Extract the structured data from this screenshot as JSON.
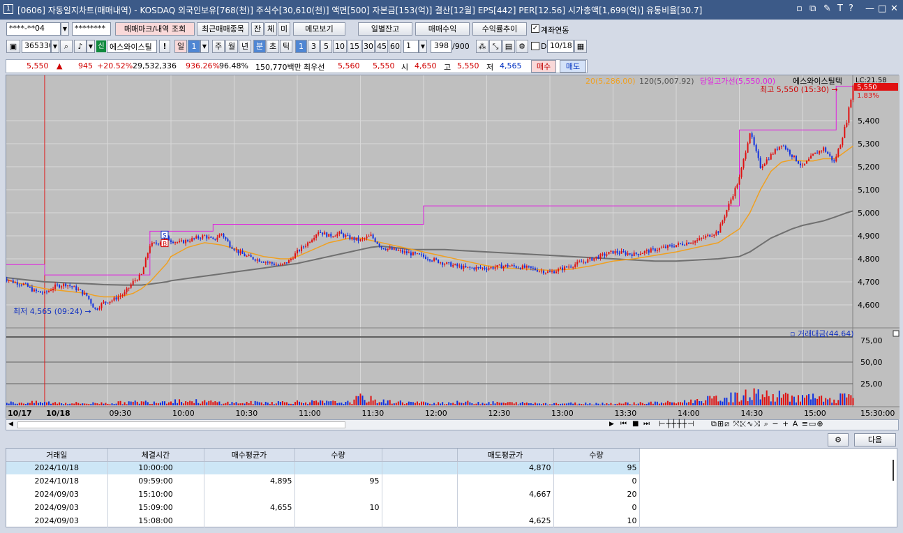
{
  "window": {
    "number": "1",
    "title": "[0606] 자동일지차트(매매내역) - KOSDAQ 외국인보유[768(천)] 주식수[30,610(천)] 액면[500] 자본금[153(억)] 결산[12월] EPS[442] PER[12.56] 시가총액[1,699(억)] 유통비율[30.7]",
    "controls": [
      "▫",
      "⧉",
      "✎",
      "T",
      "?",
      "—",
      "□",
      "✕"
    ]
  },
  "toolbar1": {
    "account": "****-**04",
    "password": "********",
    "buttons": [
      "매매마크/내역 조회",
      "최근매매종목",
      "잔",
      "체",
      "미",
      "메모보기",
      "일별잔고",
      "매매수익",
      "수익률추이"
    ],
    "checkbox_label": "계좌연동",
    "checkbox_checked": true
  },
  "toolbar2": {
    "code": "365330",
    "badge": "신",
    "stock_name": "에스와이스틸",
    "period_labels": [
      "일",
      "1",
      "주",
      "월",
      "년",
      "분",
      "초",
      "틱"
    ],
    "interval_labels": [
      "1",
      "3",
      "5",
      "10",
      "15",
      "30",
      "45",
      "60"
    ],
    "multiplier": "1",
    "count": "398",
    "count_max": "/900",
    "date_label": "D",
    "date": "10/18"
  },
  "quote": {
    "price": "5,550",
    "arrow": "▲",
    "change": "945",
    "rate": "+20.52%",
    "volume": "29,532,336",
    "vol_ratio": "936.26%",
    "strength": "96.48%",
    "amount": "150,770백만",
    "best_label": "최우선",
    "best_bid": "5,560",
    "best_ask": "5,550",
    "open_label": "시",
    "open": "4,650",
    "high_label": "고",
    "high": "5,550",
    "low_label": "저",
    "low": "4,565",
    "buy_label": "매수",
    "sell_label": "매도"
  },
  "chart_data": {
    "type": "candlestick",
    "interval": "1-minute",
    "legend": {
      "ma20": "20(5,286.00)",
      "ma120": "120(5,007.92)",
      "high_line": "당일고가선(5,550.00)",
      "name": "에스와이스틸텍"
    },
    "annotations": {
      "low": "최저 4,565 (09:24)",
      "high": "최고 5,550 (15:30)",
      "lc_label": "LC:21.58",
      "last_price_tag": "5,550",
      "pct_tag": "1.83%"
    },
    "price_axis": [
      5400,
      5300,
      5200,
      5100,
      5000,
      4900,
      4800,
      4700,
      4600
    ],
    "price_axis_labels": [
      "5,400",
      "5,300",
      "5,200",
      "5,100",
      "5,000",
      "4,900",
      "4,800",
      "4,700",
      "4,600"
    ],
    "volume_title": "거래대금(44.64)",
    "volume_axis_labels": [
      "75,00",
      "50,00",
      "25,00"
    ],
    "x_labels": [
      "10/17",
      "10/18",
      "09:30",
      "10:00",
      "10:30",
      "11:00",
      "11:30",
      "12:00",
      "12:30",
      "13:00",
      "13:30",
      "14:00",
      "14:30",
      "15:00",
      "15:30:00"
    ],
    "x_minutes": [
      -20,
      0,
      30,
      60,
      90,
      120,
      150,
      180,
      210,
      240,
      270,
      300,
      330,
      360,
      390
    ],
    "price_path_minutes": [
      -20,
      -15,
      -10,
      -5,
      0,
      5,
      10,
      15,
      20,
      24,
      28,
      32,
      38,
      42,
      46,
      50,
      54,
      58,
      60,
      64,
      68,
      72,
      76,
      80,
      84,
      88,
      92,
      96,
      100,
      104,
      108,
      112,
      116,
      120,
      125,
      130,
      135,
      140,
      145,
      150,
      155,
      160,
      165,
      170,
      175,
      180,
      190,
      200,
      210,
      220,
      230,
      240,
      250,
      260,
      270,
      280,
      290,
      300,
      310,
      320,
      330,
      335,
      340,
      345,
      350,
      355,
      360,
      365,
      370,
      375,
      378,
      381,
      384
    ],
    "price_path": [
      4720,
      4700,
      4690,
      4660,
      4650,
      4680,
      4690,
      4670,
      4640,
      4580,
      4610,
      4620,
      4650,
      4700,
      4730,
      4860,
      4870,
      4890,
      4880,
      4870,
      4880,
      4890,
      4900,
      4880,
      4910,
      4860,
      4830,
      4810,
      4800,
      4790,
      4780,
      4770,
      4790,
      4830,
      4870,
      4920,
      4900,
      4910,
      4890,
      4880,
      4900,
      4850,
      4840,
      4830,
      4820,
      4810,
      4780,
      4760,
      4760,
      4770,
      4760,
      4740,
      4770,
      4800,
      4830,
      4820,
      4840,
      4860,
      4880,
      4920,
      5150,
      5350,
      5200,
      5250,
      5300,
      5250,
      5200,
      5250,
      5280,
      5220,
      5300,
      5400,
      5550
    ],
    "ma20": [
      4720,
      4700,
      4690,
      4680,
      4670,
      4665,
      4660,
      4655,
      4650,
      4640,
      4635,
      4635,
      4640,
      4650,
      4670,
      4700,
      4740,
      4780,
      4810,
      4830,
      4850,
      4860,
      4870,
      4865,
      4860,
      4850,
      4840,
      4830,
      4820,
      4810,
      4805,
      4800,
      4800,
      4810,
      4830,
      4850,
      4870,
      4880,
      4890,
      4890,
      4880,
      4870,
      4860,
      4850,
      4840,
      4830,
      4810,
      4790,
      4770,
      4760,
      4755,
      4750,
      4755,
      4770,
      4790,
      4800,
      4815,
      4830,
      4850,
      4870,
      4930,
      5000,
      5100,
      5180,
      5220,
      5230,
      5225,
      5225,
      5235,
      5235,
      5250,
      5270,
      5290
    ],
    "ma120": [
      4720,
      4715,
      4710,
      4705,
      4700,
      4698,
      4696,
      4694,
      4692,
      4690,
      4688,
      4687,
      4686,
      4686,
      4686,
      4690,
      4695,
      4700,
      4705,
      4710,
      4715,
      4720,
      4725,
      4730,
      4735,
      4740,
      4745,
      4750,
      4755,
      4760,
      4765,
      4770,
      4775,
      4780,
      4790,
      4800,
      4810,
      4820,
      4830,
      4840,
      4850,
      4855,
      4850,
      4845,
      4840,
      4840,
      4840,
      4835,
      4830,
      4825,
      4820,
      4815,
      4810,
      4805,
      4800,
      4795,
      4790,
      4790,
      4795,
      4800,
      4810,
      4830,
      4860,
      4890,
      4910,
      4930,
      4945,
      4955,
      4965,
      4980,
      4990,
      5000,
      5008
    ],
    "high_line": 5550,
    "day_high": 5550,
    "day_low": 4565,
    "volume_peaks_minutes": [
      -20,
      0,
      20,
      40,
      55,
      60,
      90,
      120,
      145,
      150,
      160,
      180,
      200,
      240,
      270,
      300,
      330,
      335,
      340,
      345,
      350,
      355,
      360,
      365,
      370,
      375,
      380,
      384
    ],
    "volume_peaks": [
      5,
      6,
      4,
      6,
      8,
      10,
      5,
      7,
      6,
      16,
      8,
      5,
      6,
      4,
      4,
      6,
      18,
      22,
      25,
      16,
      20,
      18,
      15,
      16,
      12,
      8,
      20,
      25
    ],
    "ylim": [
      4520,
      5580
    ],
    "volume_ylim": [
      0,
      100
    ]
  },
  "lower": {
    "next_label": "다음"
  },
  "table": {
    "headers": [
      "거래일",
      "체결시간",
      "매수평균가",
      "수량",
      "",
      "매도평균가",
      "수량"
    ],
    "rows": [
      [
        "2024/10/18",
        "10:00:00",
        "",
        "",
        "",
        "4,870",
        "95"
      ],
      [
        "2024/10/18",
        "09:59:00",
        "4,895",
        "95",
        "",
        "",
        "0"
      ],
      [
        "2024/09/03",
        "15:10:00",
        "",
        "",
        "",
        "4,667",
        "20"
      ],
      [
        "2024/09/03",
        "15:09:00",
        "4,655",
        "10",
        "",
        "",
        "0"
      ],
      [
        "2024/09/03",
        "15:08:00",
        "",
        "",
        "",
        "4,625",
        "10"
      ]
    ]
  },
  "colors": {
    "title_bg": "#3c5a88",
    "up": "#e01010",
    "down": "#1030e0",
    "ma20": "#f0a020",
    "ma120": "#707070",
    "high_line": "#e020e0",
    "chart_bg": "#bfbfbf"
  }
}
